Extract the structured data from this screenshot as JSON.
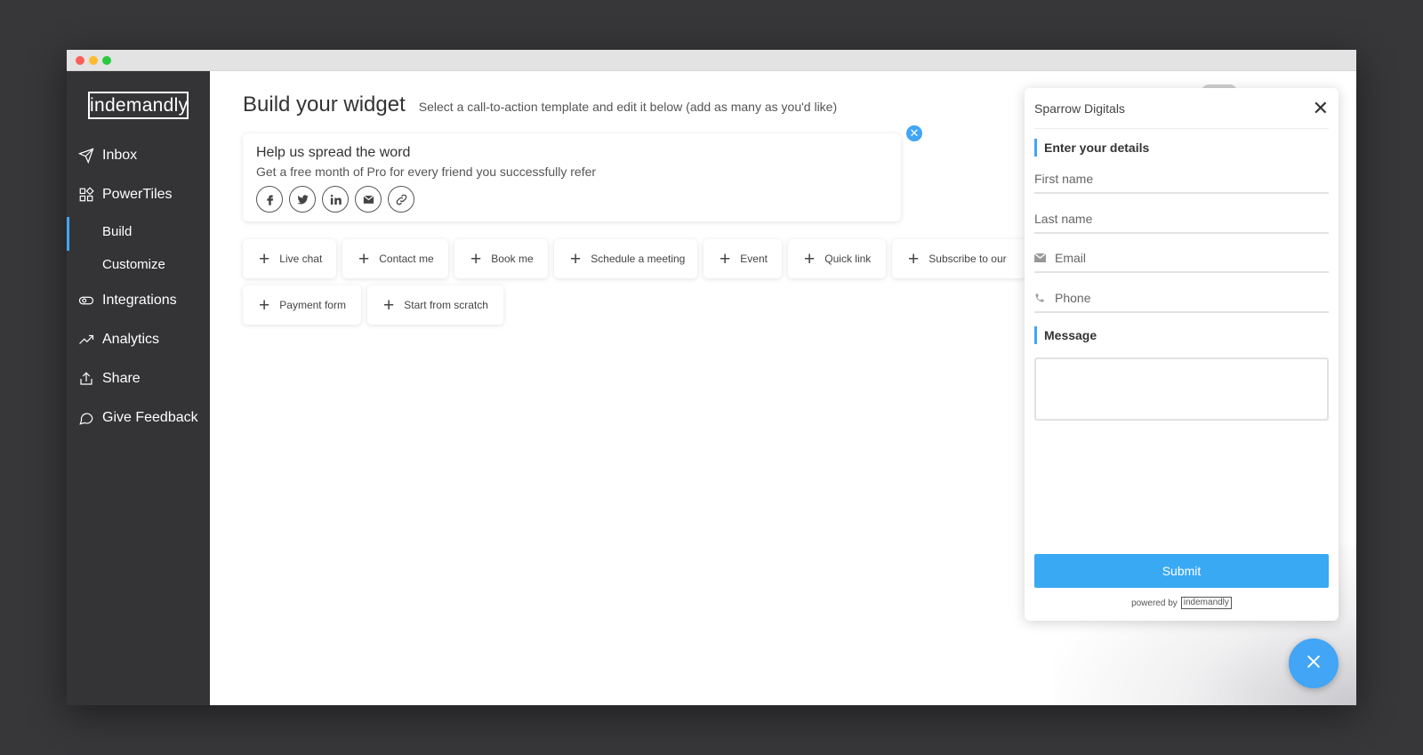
{
  "window": {
    "traffic_lights": [
      "close",
      "minimize",
      "zoom"
    ]
  },
  "sidebar": {
    "logo": "indemandly",
    "items": [
      {
        "label": "Inbox",
        "icon": "send-icon"
      },
      {
        "label": "PowerTiles",
        "icon": "grid-icon"
      },
      {
        "label": "Build",
        "sub": true,
        "active": true
      },
      {
        "label": "Customize",
        "sub": true
      },
      {
        "label": "Integrations",
        "icon": "toggle-icon"
      },
      {
        "label": "Analytics",
        "icon": "trend-icon"
      },
      {
        "label": "Share",
        "icon": "share-icon"
      },
      {
        "label": "Give Feedback",
        "icon": "chat-icon"
      }
    ],
    "accent": "#42a5f5"
  },
  "main": {
    "title": "Build your widget",
    "subtitle": "Select a call-to-action template and edit it below (add as many as you'd like)",
    "referral": {
      "title": "Help us spread the word",
      "description": "Get a free month of Pro for every friend you successfully refer",
      "share_icons": [
        "facebook-icon",
        "twitter-icon",
        "linkedin-icon",
        "email-icon",
        "link-icon"
      ]
    },
    "templates": [
      "Live chat",
      "Contact me",
      "Book me",
      "Schedule a meeting",
      "Event",
      "Quick link",
      "Subscribe to our",
      "Payment form",
      "Start from scratch"
    ]
  },
  "widget": {
    "company": "Sparrow Digitals",
    "section_details": "Enter your details",
    "fields": {
      "first_name": "First name",
      "last_name": "Last name",
      "email": "Email",
      "phone": "Phone"
    },
    "section_message": "Message",
    "submit_label": "Submit",
    "powered_by": "powered by",
    "powered_logo": "indemandly",
    "button_color": "#3aa9f4"
  }
}
